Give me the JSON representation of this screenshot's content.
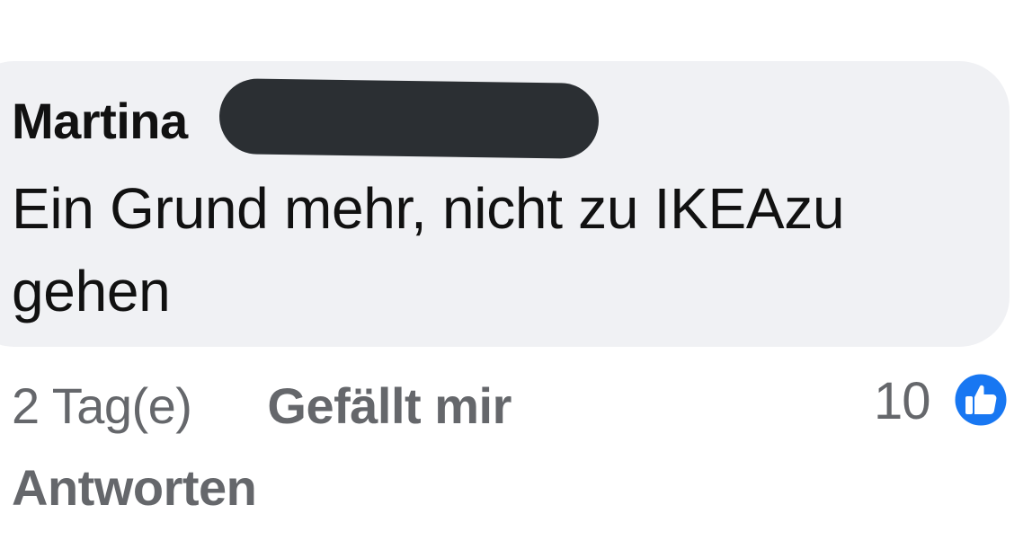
{
  "comment": {
    "author_name": "Martina",
    "author_name_redacted": true,
    "text": "Ein Grund mehr, nicht zu IKEAzu gehen",
    "timestamp": "2 Tag(e)",
    "like_label": "Gefällt mir",
    "reply_label": "Antworten",
    "reaction_count": "10",
    "reaction_icon": "thumbs-up-icon"
  },
  "colors": {
    "bubble_background": "#f0f1f4",
    "text_primary": "#111111",
    "text_secondary": "#65676b",
    "like_blue": "#1877f2",
    "redaction": "#2b2f33"
  }
}
